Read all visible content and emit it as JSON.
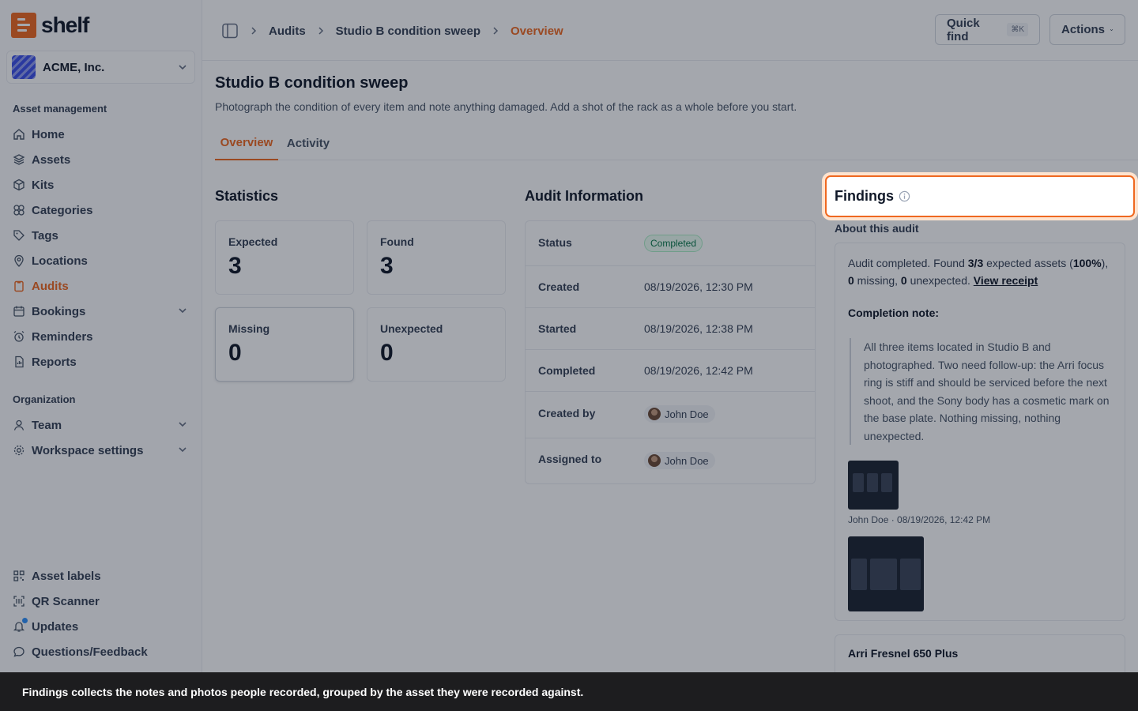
{
  "brand": {
    "name": "shelf",
    "accent": "#ef6820"
  },
  "org": {
    "name": "ACME, Inc."
  },
  "sidebar": {
    "section_asset": "Asset management",
    "items": [
      {
        "label": "Home",
        "icon": "home-icon"
      },
      {
        "label": "Assets",
        "icon": "layers-icon"
      },
      {
        "label": "Kits",
        "icon": "box-icon"
      },
      {
        "label": "Categories",
        "icon": "shapes-icon"
      },
      {
        "label": "Tags",
        "icon": "tag-icon"
      },
      {
        "label": "Locations",
        "icon": "map-pin-icon"
      },
      {
        "label": "Audits",
        "icon": "clipboard-icon",
        "active": true
      },
      {
        "label": "Bookings",
        "icon": "calendar-icon"
      },
      {
        "label": "Reminders",
        "icon": "alarm-icon"
      },
      {
        "label": "Reports",
        "icon": "report-icon"
      }
    ],
    "section_org": "Organization",
    "org_items": [
      {
        "label": "Team",
        "icon": "user-icon"
      },
      {
        "label": "Workspace settings",
        "icon": "gear-icon"
      }
    ],
    "bottom_items": [
      {
        "label": "Asset labels",
        "icon": "qr-icon"
      },
      {
        "label": "QR Scanner",
        "icon": "scan-icon"
      },
      {
        "label": "Updates",
        "icon": "bell-icon"
      },
      {
        "label": "Questions/Feedback",
        "icon": "chat-icon"
      }
    ]
  },
  "header": {
    "crumbs": [
      "Audits",
      "Studio B condition sweep",
      "Overview"
    ],
    "quick_find": "Quick find",
    "shortcut": "⌘K",
    "actions": "Actions"
  },
  "page": {
    "title": "Studio B condition sweep",
    "subtitle": "Photograph the condition of every item and note anything damaged. Add a shot of the rack as a whole before you start.",
    "tabs": [
      "Overview",
      "Activity"
    ]
  },
  "statistics": {
    "heading": "Statistics",
    "expected": {
      "label": "Expected",
      "value": "3"
    },
    "found": {
      "label": "Found",
      "value": "3"
    },
    "missing": {
      "label": "Missing",
      "value": "0"
    },
    "unexpected": {
      "label": "Unexpected",
      "value": "0"
    }
  },
  "audit_info": {
    "heading": "Audit Information",
    "status_label": "Status",
    "status": "Completed",
    "created_label": "Created",
    "created": "08/19/2026, 12:30 PM",
    "started_label": "Started",
    "started": "08/19/2026, 12:38 PM",
    "completed_label": "Completed",
    "completed": "08/19/2026, 12:42 PM",
    "created_by_label": "Created by",
    "created_by": "John Doe",
    "assigned_label": "Assigned to",
    "assigned": "John Doe"
  },
  "findings": {
    "heading": "Findings",
    "about": "About this audit",
    "summary_a": "Audit completed. Found ",
    "summary_b": "3/3",
    "summary_c": " expected assets (",
    "summary_d": "100%",
    "summary_e": "), ",
    "summary_f": "0",
    "summary_g": " missing, ",
    "summary_h": "0",
    "summary_i": " unexpected. ",
    "receipt": "View receipt",
    "completion_title": "Completion note:",
    "note": "All three items located in Studio B and photographed. Two need follow-up: the Arri focus ring is stiff and should be serviced before the next shoot, and the Sony body has a cosmetic mark on the base plate. Nothing missing, nothing unexpected.",
    "photo_meta": "John Doe · 08/19/2026, 12:42 PM",
    "asset_title": "Arri Fresnel 650 Plus"
  },
  "toast": "Findings collects the notes and photos people recorded, grouped by the asset they were recorded against."
}
